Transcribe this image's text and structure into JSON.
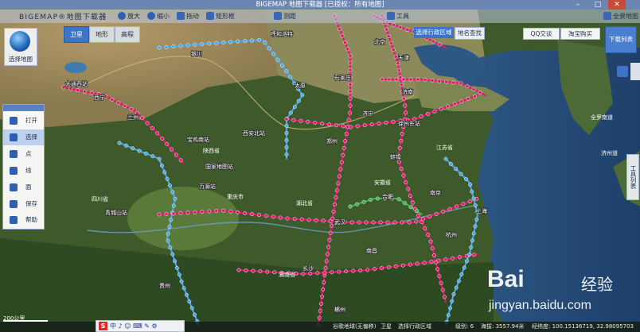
{
  "window": {
    "title": "BIGEMAP 地图下载器 [已授权：所有地图]",
    "min": "–",
    "max": "□",
    "close": "✕"
  },
  "toolbar": {
    "logo": "BIGEMAP®地图下载器",
    "items": [
      {
        "label": "放大",
        "icon": "zoom-in-icon"
      },
      {
        "label": "缩小",
        "icon": "zoom-out-icon"
      },
      {
        "label": "拖动",
        "icon": "hand-icon"
      },
      {
        "label": "矩形框",
        "icon": "rectangle-icon"
      },
      {
        "label": "测距",
        "icon": "ruler-icon"
      },
      {
        "label": "工具",
        "icon": "tools-icon"
      },
      {
        "label": "全景地图",
        "icon": "panorama-icon"
      }
    ]
  },
  "map_type": {
    "tabs": [
      "卫星",
      "地形",
      "高程"
    ],
    "active": "卫星"
  },
  "select_map": "选择地图",
  "region_select": "选择行政区域",
  "place_search": "地名查找",
  "qq": "QQ交谈",
  "shop": "淘宝购买",
  "download_list": "下载列表",
  "right_tools": "工具列表",
  "left_panel": {
    "items": [
      {
        "label": "打开",
        "icon": "folder-icon"
      },
      {
        "label": "选择",
        "icon": "pointer-icon"
      },
      {
        "label": "点",
        "icon": "marker-icon"
      },
      {
        "label": "线",
        "icon": "line-icon"
      },
      {
        "label": "面",
        "icon": "polygon-icon"
      },
      {
        "label": "保存",
        "icon": "save-icon"
      },
      {
        "label": "帮助",
        "icon": "help-icon"
      }
    ],
    "active": "选择"
  },
  "map_labels": [
    {
      "text": "大通西站"
    },
    {
      "text": "西宁"
    },
    {
      "text": "兰州"
    },
    {
      "text": "银川"
    },
    {
      "text": "呼和浩特"
    },
    {
      "text": "北京"
    },
    {
      "text": "天津"
    },
    {
      "text": "石家庄"
    },
    {
      "text": "太原"
    },
    {
      "text": "济南"
    },
    {
      "text": "郑州"
    },
    {
      "text": "西安北站"
    },
    {
      "text": "宝鸡南站"
    },
    {
      "text": "陕西省"
    },
    {
      "text": "国家地图站"
    },
    {
      "text": "万源站"
    },
    {
      "text": "重庆市"
    },
    {
      "text": "四川省"
    },
    {
      "text": "湖北省"
    },
    {
      "text": "安徽省"
    },
    {
      "text": "江苏省"
    },
    {
      "text": "上海"
    },
    {
      "text": "南京"
    },
    {
      "text": "合肥"
    },
    {
      "text": "武汉"
    },
    {
      "text": "长沙"
    },
    {
      "text": "南昌"
    },
    {
      "text": "杭州"
    },
    {
      "text": "湖南省"
    },
    {
      "text": "贵州"
    },
    {
      "text": "青城山站"
    },
    {
      "text": "济州道"
    },
    {
      "text": "全罗南道"
    },
    {
      "text": "郴州"
    },
    {
      "text": "徐州东站"
    },
    {
      "text": "济宁"
    },
    {
      "text": "蚌埠"
    }
  ],
  "status": {
    "scale": "200公里",
    "map_source": "谷歌地球(无偏移)",
    "layer": "卫星",
    "mode": "选择行政区域",
    "level": "级别: 6",
    "altitude": "海拔: 3557.94米",
    "coords": "经纬度: 100.15136719, 32.98095703"
  },
  "watermark": {
    "brand": "Bai",
    "jingyan": "经验",
    "url": "jingyan.baidu.com"
  },
  "colors": {
    "titlebar": "#6b86b3",
    "accent": "#3f73c8",
    "route_red": "#e0186f",
    "route_blue": "#4aa6e8",
    "route_green": "#37b54a"
  }
}
